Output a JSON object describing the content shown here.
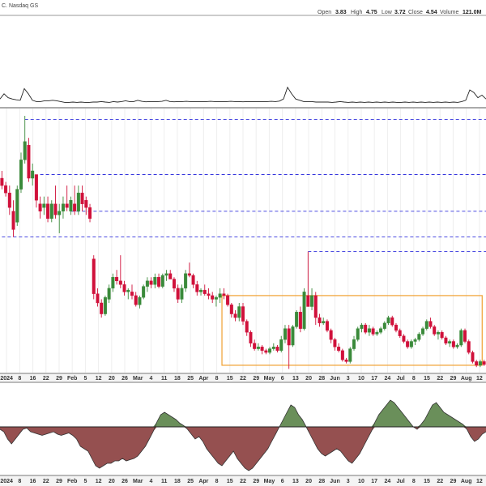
{
  "header": {
    "exchange": "C. Nasdaq GS",
    "open_label": "Open",
    "open_value": "3.83",
    "high_label": "High",
    "high_value": "4.75",
    "low_label": "Low",
    "low_value": "3.72",
    "close_label": "Close",
    "close_value": "4.54",
    "volume_label": "Volume",
    "volume_value": "121.0M"
  },
  "colors": {
    "up": "#3a8a3a",
    "down": "#d0103a",
    "blue_dash": "#3333dd",
    "orange_box": "#f0a030",
    "area_pos": "#6a8f5a",
    "area_neg": "#955050"
  },
  "chart_data": [
    {
      "type": "line",
      "panel": "top-indicator",
      "values": [
        0.15,
        0.35,
        0.2,
        0.15,
        0.12,
        0.1,
        0.55,
        0.35,
        0.1,
        0.05,
        0.05,
        0.08,
        0.08,
        0.1,
        0.08,
        0.05,
        0.02,
        0.02,
        0.03,
        0.02,
        0.03,
        0.02,
        0.02,
        0.03,
        0.03,
        0.05,
        0.03,
        0.02,
        0.05,
        0.03,
        0.05,
        0.08,
        0.05,
        0.05,
        0.1,
        0.06,
        0.04,
        0.05,
        0.05,
        0.05,
        0.06,
        0.1,
        0.05,
        0.04,
        0.05,
        0.05,
        0.06,
        0.05,
        0.05,
        0.05,
        0.05,
        0.05,
        0.06,
        0.05,
        0.05,
        0.05,
        0.05,
        0.06,
        0.05,
        0.05,
        0.04,
        0.05,
        0.05,
        0.05,
        0.05,
        0.05,
        0.05,
        0.06,
        0.05,
        0.07,
        0.15,
        0.6,
        0.35,
        0.15,
        0.1,
        0.05,
        0.05,
        0.05,
        0.03,
        0.03,
        0.03,
        0.03,
        0.02,
        0.03,
        0.05,
        0.03,
        0.02,
        0.03,
        0.02,
        0.03,
        0.02,
        0.03,
        0.02,
        0.03,
        0.02,
        0.03,
        0.02,
        0.03,
        0.02,
        0.02,
        0.03,
        0.02,
        0.03,
        0.02,
        0.03,
        0.02,
        0.03,
        0.02,
        0.03,
        0.02,
        0.03,
        0.02,
        0.03,
        0.02,
        0.05,
        0.1,
        0.5,
        0.4,
        0.2,
        0.3,
        0.15
      ]
    },
    {
      "type": "candlestick",
      "panel": "price",
      "x_labels": [
        "2024",
        "8",
        "16",
        "22",
        "29",
        "Feb",
        "5",
        "12",
        "20",
        "26",
        "Mar",
        "4",
        "11",
        "18",
        "25",
        "Apr",
        "8",
        "15",
        "22",
        "29",
        "May",
        "6",
        "13",
        "20",
        "28",
        "Jun",
        "3",
        "10",
        "17",
        "24",
        "Jul",
        "8",
        "15",
        "22",
        "29",
        "Aug",
        "12"
      ],
      "ohlc": [
        [
          6.5,
          6.7,
          6.2,
          6.3
        ],
        [
          6.3,
          6.4,
          6.0,
          6.1
        ],
        [
          6.1,
          6.3,
          5.5,
          5.7
        ],
        [
          5.6,
          5.9,
          4.9,
          5.1
        ],
        [
          5.3,
          6.3,
          5.2,
          6.2
        ],
        [
          6.2,
          7.2,
          6.1,
          7.0
        ],
        [
          7.0,
          8.2,
          6.9,
          7.5
        ],
        [
          7.4,
          7.6,
          6.4,
          6.5
        ],
        [
          6.5,
          6.9,
          6.3,
          6.7
        ],
        [
          6.6,
          6.6,
          5.7,
          5.9
        ],
        [
          5.8,
          6.0,
          5.4,
          5.6
        ],
        [
          5.7,
          6.0,
          5.5,
          5.8
        ],
        [
          5.8,
          6.0,
          5.3,
          5.4
        ],
        [
          5.4,
          5.9,
          5.3,
          5.8
        ],
        [
          5.8,
          6.3,
          5.4,
          5.5
        ],
        [
          5.5,
          5.8,
          5.0,
          5.6
        ],
        [
          5.6,
          6.0,
          5.4,
          5.8
        ],
        [
          5.8,
          6.3,
          5.6,
          5.7
        ],
        [
          5.6,
          6.0,
          5.5,
          5.9
        ],
        [
          5.8,
          6.3,
          5.5,
          5.6
        ],
        [
          5.6,
          6.3,
          5.5,
          6.1
        ],
        [
          6.1,
          6.3,
          5.6,
          5.8
        ],
        [
          5.9,
          6.0,
          5.5,
          5.7
        ],
        [
          5.7,
          5.8,
          5.3,
          5.4
        ],
        [
          4.3,
          4.4,
          3.2,
          3.35
        ],
        [
          3.35,
          3.5,
          3.0,
          3.1
        ],
        [
          3.1,
          3.2,
          2.7,
          2.8
        ],
        [
          2.8,
          3.3,
          2.75,
          3.25
        ],
        [
          3.2,
          3.6,
          3.1,
          3.5
        ],
        [
          3.5,
          3.9,
          3.4,
          3.8
        ],
        [
          3.8,
          4.0,
          3.6,
          3.7
        ],
        [
          3.7,
          4.4,
          3.5,
          3.6
        ],
        [
          3.6,
          3.7,
          3.3,
          3.4
        ],
        [
          3.4,
          3.5,
          3.2,
          3.45
        ],
        [
          3.4,
          3.6,
          3.2,
          3.3
        ],
        [
          3.3,
          3.4,
          3.0,
          3.05
        ],
        [
          3.05,
          3.3,
          2.95,
          3.25
        ],
        [
          3.25,
          3.6,
          3.2,
          3.55
        ],
        [
          3.55,
          3.8,
          3.4,
          3.7
        ],
        [
          3.7,
          3.8,
          3.5,
          3.6
        ],
        [
          3.6,
          3.9,
          3.5,
          3.8
        ],
        [
          3.8,
          3.9,
          3.5,
          3.55
        ],
        [
          3.55,
          3.9,
          3.5,
          3.85
        ],
        [
          3.85,
          4.0,
          3.7,
          3.9
        ],
        [
          3.9,
          4.0,
          3.8,
          3.75
        ],
        [
          3.75,
          3.8,
          3.4,
          3.5
        ],
        [
          3.5,
          3.6,
          3.1,
          3.2
        ],
        [
          3.2,
          3.6,
          3.1,
          3.5
        ],
        [
          3.5,
          4.0,
          3.4,
          3.9
        ],
        [
          3.9,
          4.2,
          3.8,
          3.85
        ],
        [
          3.85,
          3.9,
          3.5,
          3.6
        ],
        [
          3.6,
          3.7,
          3.3,
          3.4
        ],
        [
          3.4,
          3.5,
          3.3,
          3.45
        ],
        [
          3.45,
          3.6,
          3.3,
          3.35
        ],
        [
          3.35,
          3.5,
          3.2,
          3.3
        ],
        [
          3.3,
          3.4,
          3.1,
          3.2
        ],
        [
          3.2,
          3.3,
          3.0,
          3.25
        ],
        [
          3.25,
          3.5,
          3.1,
          3.35
        ],
        [
          3.35,
          3.5,
          3.2,
          3.3
        ],
        [
          3.3,
          3.35,
          3.0,
          3.05
        ],
        [
          3.05,
          3.1,
          2.7,
          2.8
        ],
        [
          2.8,
          2.9,
          2.6,
          2.7
        ],
        [
          2.7,
          3.1,
          2.6,
          3.0
        ],
        [
          3.0,
          3.1,
          2.5,
          2.6
        ],
        [
          2.6,
          2.65,
          2.2,
          2.3
        ],
        [
          2.3,
          2.35,
          1.9,
          2.0
        ],
        [
          2.0,
          2.1,
          1.8,
          1.85
        ],
        [
          1.85,
          2.0,
          1.8,
          1.9
        ],
        [
          1.9,
          1.95,
          1.7,
          1.8
        ],
        [
          1.8,
          1.85,
          1.7,
          1.75
        ],
        [
          1.75,
          1.9,
          1.7,
          1.85
        ],
        [
          1.85,
          2.0,
          1.8,
          1.9
        ],
        [
          1.9,
          1.95,
          1.75,
          1.8
        ],
        [
          1.8,
          2.2,
          1.75,
          2.1
        ],
        [
          2.1,
          2.5,
          2.0,
          2.4
        ],
        [
          2.4,
          2.5,
          1.3,
          1.95
        ],
        [
          1.95,
          2.5,
          1.9,
          2.45
        ],
        [
          2.45,
          2.9,
          2.4,
          2.85
        ],
        [
          2.85,
          3.0,
          2.3,
          2.4
        ],
        [
          2.4,
          3.5,
          2.35,
          3.4
        ],
        [
          3.3,
          4.5,
          3.25,
          3.0
        ],
        [
          3.0,
          3.5,
          2.9,
          3.3
        ],
        [
          3.3,
          3.4,
          2.5,
          2.7
        ],
        [
          2.7,
          2.8,
          2.45,
          2.55
        ],
        [
          2.55,
          2.7,
          2.5,
          2.6
        ],
        [
          2.6,
          2.65,
          2.3,
          2.35
        ],
        [
          2.35,
          2.4,
          2.0,
          2.1
        ],
        [
          2.1,
          2.15,
          1.8,
          1.9
        ],
        [
          1.9,
          2.0,
          1.75,
          1.8
        ],
        [
          1.8,
          1.85,
          1.5,
          1.55
        ],
        [
          1.55,
          1.6,
          1.45,
          1.5
        ],
        [
          1.5,
          1.9,
          1.45,
          1.85
        ],
        [
          1.85,
          2.2,
          1.8,
          2.1
        ],
        [
          2.1,
          2.45,
          2.05,
          2.4
        ],
        [
          2.4,
          2.55,
          2.3,
          2.5
        ],
        [
          2.5,
          2.55,
          2.25,
          2.3
        ],
        [
          2.3,
          2.5,
          2.2,
          2.4
        ],
        [
          2.4,
          2.45,
          2.2,
          2.25
        ],
        [
          2.25,
          2.35,
          2.2,
          2.3
        ],
        [
          2.3,
          2.45,
          2.25,
          2.4
        ],
        [
          2.4,
          2.6,
          2.35,
          2.55
        ],
        [
          2.55,
          2.75,
          2.5,
          2.7
        ],
        [
          2.7,
          2.75,
          2.45,
          2.5
        ],
        [
          2.5,
          2.55,
          2.3,
          2.35
        ],
        [
          2.35,
          2.4,
          2.15,
          2.2
        ],
        [
          2.2,
          2.25,
          2.0,
          2.05
        ],
        [
          2.05,
          2.1,
          1.85,
          1.9
        ],
        [
          1.9,
          2.1,
          1.85,
          2.05
        ],
        [
          2.05,
          2.15,
          1.95,
          2.1
        ],
        [
          2.1,
          2.3,
          2.05,
          2.25
        ],
        [
          2.25,
          2.45,
          2.2,
          2.4
        ],
        [
          2.4,
          2.65,
          2.35,
          2.6
        ],
        [
          2.6,
          2.7,
          2.4,
          2.45
        ],
        [
          2.45,
          2.5,
          2.2,
          2.25
        ],
        [
          2.25,
          2.35,
          2.1,
          2.3
        ],
        [
          2.3,
          2.35,
          2.1,
          2.15
        ],
        [
          2.15,
          2.2,
          1.95,
          2.0
        ],
        [
          2.0,
          2.1,
          1.9,
          2.05
        ],
        [
          2.05,
          2.1,
          1.85,
          1.9
        ],
        [
          1.9,
          2.0,
          1.85,
          1.95
        ],
        [
          1.95,
          2.4,
          1.9,
          2.35
        ],
        [
          2.35,
          2.4,
          2.0,
          2.05
        ],
        [
          2.05,
          2.1,
          1.7,
          1.75
        ],
        [
          1.75,
          1.8,
          1.45,
          1.5
        ],
        [
          1.5,
          1.55,
          1.35,
          1.4
        ],
        [
          1.4,
          1.55,
          1.35,
          1.5
        ],
        [
          1.5,
          1.55,
          1.38,
          1.42
        ]
      ],
      "y_range": [
        1.2,
        8.4
      ],
      "reference_levels": [
        {
          "value": 8.1,
          "x_start_index": 6
        },
        {
          "value": 6.6,
          "x_start_index": 10
        },
        {
          "value": 5.6,
          "x_start_index": 18
        },
        {
          "value": 4.9,
          "x_start_index": 0
        },
        {
          "value": 4.5,
          "x_start_index": 80
        }
      ],
      "range_box": {
        "start_index": 58,
        "end_index": 125,
        "top": 3.3,
        "bottom": 1.4
      },
      "grid": true
    },
    {
      "type": "area",
      "panel": "bottom-oscillator",
      "x_labels": [
        "2024",
        "8",
        "16",
        "22",
        "29",
        "Feb",
        "5",
        "12",
        "20",
        "26",
        "Mar",
        "4",
        "11",
        "18",
        "25",
        "Apr",
        "8",
        "15",
        "22",
        "29",
        "May",
        "6",
        "13",
        "20",
        "28",
        "Jun",
        "3",
        "10",
        "17",
        "24",
        "Jul",
        "8",
        "15",
        "22",
        "29",
        "Aug",
        "12"
      ],
      "values": [
        -0.1,
        -0.2,
        -0.5,
        -0.7,
        -0.5,
        -0.3,
        -0.1,
        -0.05,
        -0.2,
        -0.25,
        -0.3,
        -0.35,
        -0.3,
        -0.25,
        -0.2,
        -0.3,
        -0.35,
        -0.3,
        -0.25,
        -0.35,
        -0.5,
        -0.8,
        -0.9,
        -1.0,
        -1.3,
        -1.6,
        -1.7,
        -1.6,
        -1.5,
        -1.5,
        -1.4,
        -1.4,
        -1.3,
        -1.4,
        -1.35,
        -1.3,
        -1.2,
        -1.0,
        -0.8,
        -0.5,
        -0.2,
        0.2,
        0.5,
        0.6,
        0.5,
        0.4,
        0.3,
        0.15,
        0.05,
        -0.1,
        -0.3,
        -0.5,
        -0.4,
        -0.6,
        -0.9,
        -1.1,
        -1.3,
        -1.5,
        -1.6,
        -1.4,
        -1.2,
        -1.0,
        -1.3,
        -1.5,
        -1.7,
        -1.8,
        -1.7,
        -1.5,
        -1.3,
        -1.1,
        -0.9,
        -0.6,
        -0.3,
        0.0,
        0.3,
        0.6,
        0.9,
        0.8,
        0.5,
        0.3,
        0.0,
        -0.3,
        -0.6,
        -0.9,
        -1.1,
        -1.2,
        -1.1,
        -1.0,
        -0.9,
        -1.0,
        -1.2,
        -1.4,
        -1.5,
        -1.3,
        -1.1,
        -0.8,
        -0.5,
        -0.2,
        0.2,
        0.5,
        0.7,
        0.9,
        1.1,
        1.0,
        0.8,
        0.6,
        0.4,
        0.2,
        0.0,
        -0.1,
        0.1,
        0.3,
        0.6,
        0.9,
        1.0,
        0.8,
        0.6,
        0.5,
        0.4,
        0.3,
        0.2,
        0.1,
        -0.1,
        -0.4,
        -0.6,
        -0.5,
        -0.3,
        -0.2
      ]
    }
  ]
}
